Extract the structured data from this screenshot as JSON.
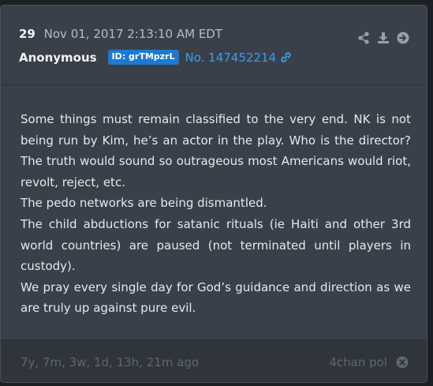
{
  "post": {
    "number": "29",
    "date": "Nov 01, 2017 2:13:10 AM EDT",
    "author": "Anonymous",
    "id_badge": "ID: grTMpzrL",
    "post_no": "No. 147452214"
  },
  "body": {
    "lines": [
      "Some things must remain classified to the very end. NK is not being run by Kim, he’s an actor in the play. Who is the director? The truth would sound so outrageous most Americans would riot, revolt, reject, etc.",
      "The pedo networks are being dismantled.",
      "The child abductions for satanic rituals (ie Haiti and other 3rd world countries) are paused (not terminated until players in custody).",
      "We pray every single day for God’s guidance and direction as we are truly up against pure evil."
    ]
  },
  "footer": {
    "age": "7y, 7m, 3w, 1d, 13h, 21m ago",
    "source": "4chan pol"
  },
  "icons": {
    "share": "share-icon",
    "download": "download-icon",
    "open": "arrow-right-circle-icon",
    "link": "link-icon",
    "close": "close-circle-icon"
  },
  "colors": {
    "card_bg": "#3a4049",
    "accent_blue": "#1f78d1",
    "link_blue": "#3a9eea",
    "text": "#e6e8eb",
    "muted": "#5f666f"
  }
}
